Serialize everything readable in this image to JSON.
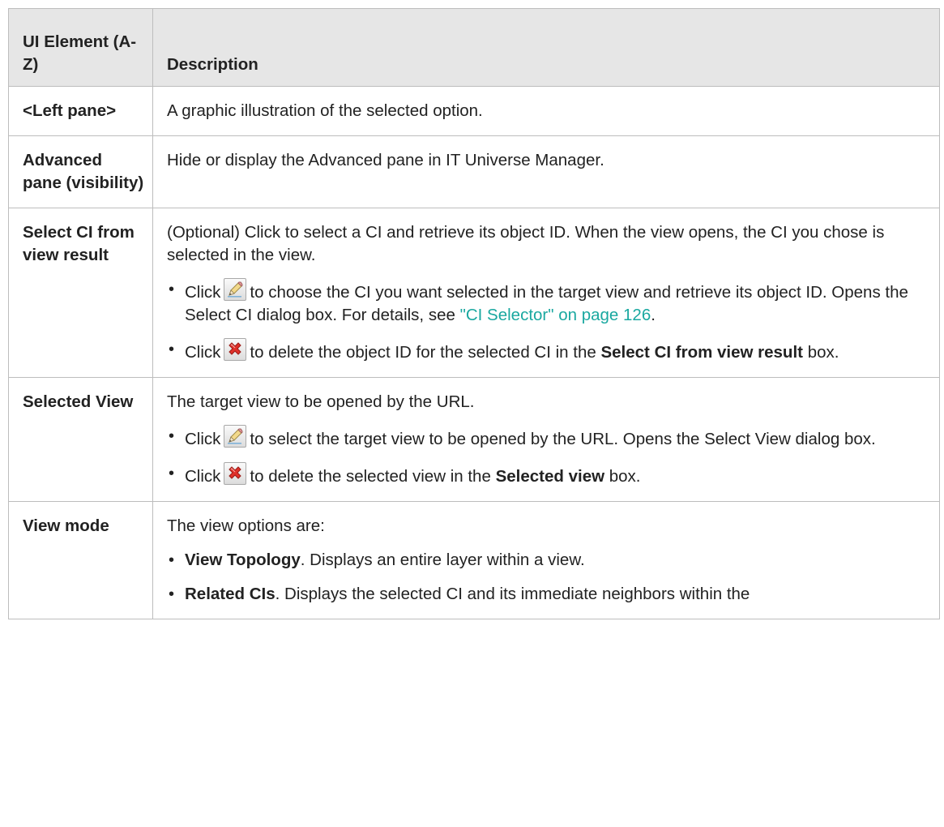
{
  "table": {
    "header": {
      "col1": "UI Element (A-Z)",
      "col2": "Description"
    },
    "rows": {
      "left_pane": {
        "name": "<Left pane>",
        "desc": "A graphic illustration of the selected option."
      },
      "advanced_pane": {
        "name": "Advanced pane (visibility)",
        "desc": "Hide or display the Advanced pane in IT Universe Manager."
      },
      "select_ci": {
        "name": "Select CI from view result",
        "desc": "(Optional) Click to select a CI and retrieve its object ID. When the view opens, the CI you chose is selected in the view.",
        "b1_prefix": "Click",
        "b1_icon": "pencil-edit-icon",
        "b1_text": "to choose the CI you want selected in the target view and retrieve its object ID. Opens the Select CI dialog box. For details, see",
        "b1_link": "\"CI Selector\" on page 126",
        "b1_end": ".",
        "b2_prefix": "Click",
        "b2_icon": "red-x-delete-icon",
        "b2_text": "to delete the object ID for the selected CI in the",
        "b2_bold": "Select CI from view result",
        "b2_end": "box."
      },
      "selected_view": {
        "name": "Selected View",
        "desc": "The target view to be opened by the URL.",
        "b1_prefix": "Click",
        "b1_icon": "pencil-edit-icon",
        "b1_text": "to select the target view to be opened by the URL. Opens the Select View dialog box.",
        "b2_prefix": "Click",
        "b2_icon": "red-x-delete-icon",
        "b2_text": "to delete the selected view in the",
        "b2_bold": "Selected view",
        "b2_end": "box."
      },
      "view_mode": {
        "name": "View mode",
        "desc": "The view options are:",
        "b1_bold": "View Topology",
        "b1_text": ". Displays an entire layer within a view.",
        "b2_bold": "Related CIs",
        "b2_text": ". Displays the selected CI and its immediate neighbors within the"
      }
    }
  },
  "colors": {
    "link": "#1aa8a0",
    "header_bg": "#e6e6e6",
    "border": "#bdbdbd"
  }
}
